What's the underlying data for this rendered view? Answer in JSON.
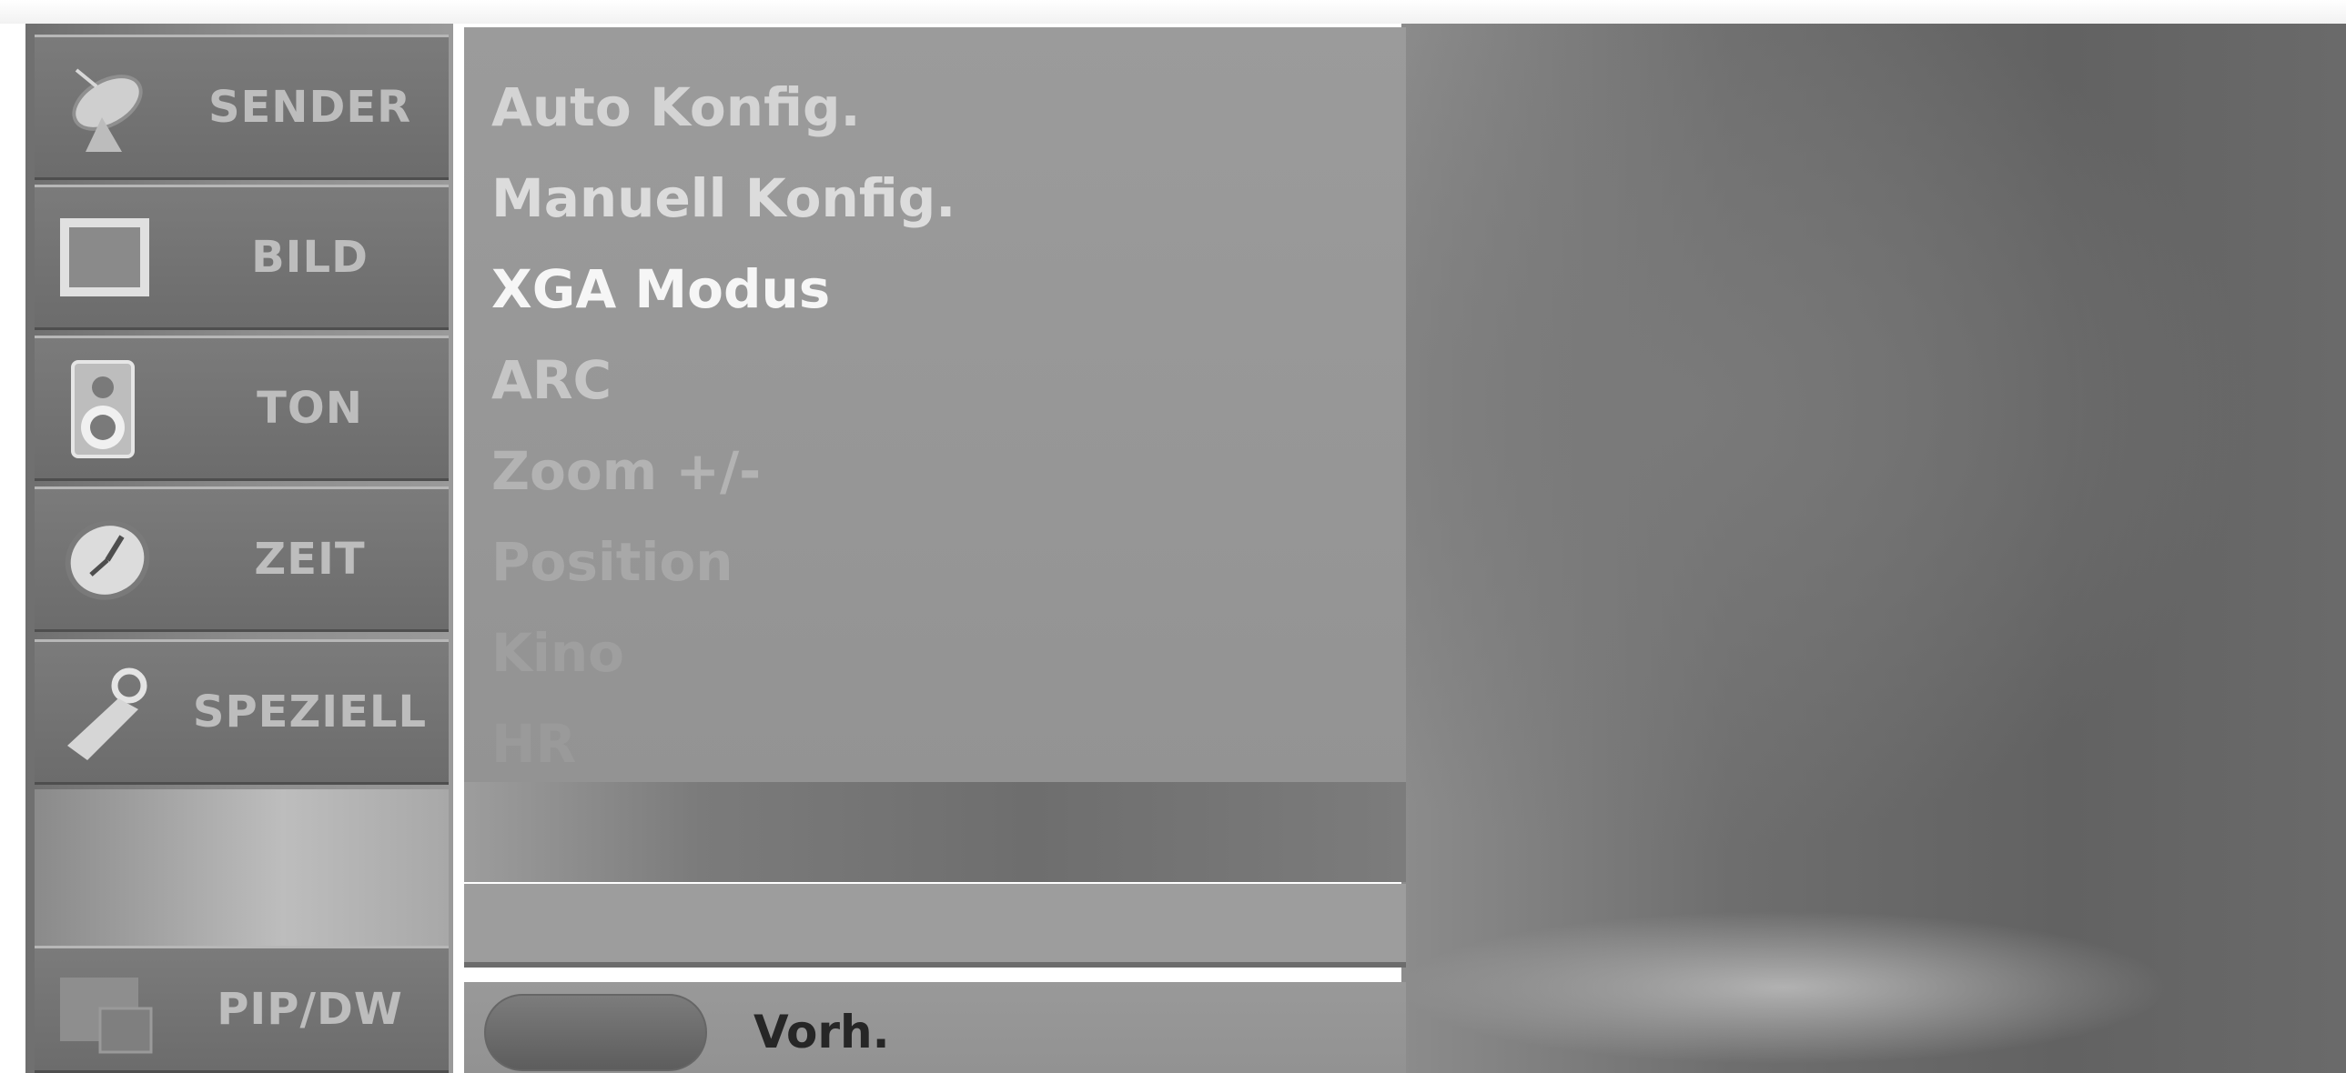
{
  "categories": [
    {
      "label": "SENDER",
      "icon": "satellite-dish-icon"
    },
    {
      "label": "BILD",
      "icon": "screen-icon"
    },
    {
      "label": "TON",
      "icon": "speaker-icon"
    },
    {
      "label": "ZEIT",
      "icon": "clock-icon"
    },
    {
      "label": "SPEZIELL",
      "icon": "wrench-icon"
    },
    {
      "label": "PIP/DW",
      "icon": "pip-icon"
    }
  ],
  "submenu": {
    "items": [
      {
        "label": "Auto Konfig."
      },
      {
        "label": "Manuell Konfig."
      },
      {
        "label": "XGA Modus"
      },
      {
        "label": "ARC"
      },
      {
        "label": "Zoom +/-"
      },
      {
        "label": "Position"
      },
      {
        "label": "Kino"
      },
      {
        "label": "HR"
      }
    ]
  },
  "footer": {
    "prev_label": "Vorh."
  },
  "colors": {
    "item_highlighted": "#f4f4f4",
    "item_normal": "#c8c8c8",
    "item_dim": "#a6a6a6",
    "category_text": "#bdbdbd"
  }
}
